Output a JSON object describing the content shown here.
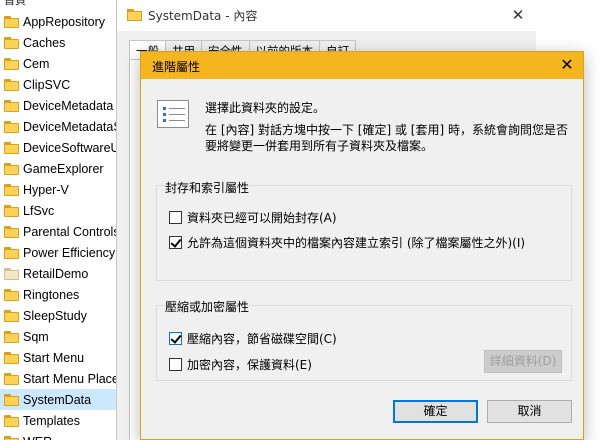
{
  "explorer": {
    "cut_top_label": "首頁",
    "folders": [
      {
        "label": "AppRepository",
        "selected": false,
        "plain": false
      },
      {
        "label": "Caches",
        "selected": false,
        "plain": false
      },
      {
        "label": "Cem",
        "selected": false,
        "plain": false
      },
      {
        "label": "ClipSVC",
        "selected": false,
        "plain": false
      },
      {
        "label": "DeviceMetadata",
        "selected": false,
        "plain": false
      },
      {
        "label": "DeviceMetadataS",
        "selected": false,
        "plain": false
      },
      {
        "label": "DeviceSoftwareU",
        "selected": false,
        "plain": false
      },
      {
        "label": "GameExplorer",
        "selected": false,
        "plain": false
      },
      {
        "label": "Hyper-V",
        "selected": false,
        "plain": false
      },
      {
        "label": "LfSvc",
        "selected": false,
        "plain": false
      },
      {
        "label": "Parental Controls",
        "selected": false,
        "plain": false
      },
      {
        "label": "Power Efficiency",
        "selected": false,
        "plain": false
      },
      {
        "label": "RetailDemo",
        "selected": false,
        "plain": true
      },
      {
        "label": "Ringtones",
        "selected": false,
        "plain": false
      },
      {
        "label": "SleepStudy",
        "selected": false,
        "plain": false
      },
      {
        "label": "Sqm",
        "selected": false,
        "plain": false
      },
      {
        "label": "Start Menu",
        "selected": false,
        "plain": false
      },
      {
        "label": "Start Menu Place",
        "selected": false,
        "plain": false
      },
      {
        "label": "SystemData",
        "selected": true,
        "plain": false
      },
      {
        "label": "Templates",
        "selected": false,
        "plain": false
      },
      {
        "label": "WER",
        "selected": false,
        "plain": false
      }
    ]
  },
  "properties_window": {
    "title": "SystemData - 內容",
    "close_glyph": "✕",
    "tabs": [
      "一般",
      "共用",
      "安全性",
      "以前的版本",
      "自訂"
    ]
  },
  "advanced_dialog": {
    "title": "進階屬性",
    "close_glyph": "✕",
    "intro": "選擇此資料夾的設定。",
    "description": "在 [內容] 對話方塊中按一下 [確定] 或 [套用] 時，系統會詢問您是否要將變更一併套用到所有子資料夾及檔案。",
    "archive_group": {
      "label": "封存和索引屬性",
      "options": [
        {
          "label": "資料夾已經可以開始封存(A)",
          "checked": false
        },
        {
          "label": "允許為這個資料夾中的檔案內容建立索引 (除了檔案屬性之外)(I)",
          "checked": true
        }
      ]
    },
    "compress_group": {
      "label": "壓縮或加密屬性",
      "options": [
        {
          "label": "壓縮內容，節省磁碟空間(C)",
          "checked": true
        },
        {
          "label": "加密內容，保護資料(E)",
          "checked": false
        }
      ],
      "details_button": "詳細資料(D)"
    },
    "ok_button": "確定",
    "cancel_button": "取消"
  },
  "colors": {
    "dialog_titlebar": "#f5b51e",
    "selection": "#cce8ff",
    "focus_border": "#0078d7"
  }
}
